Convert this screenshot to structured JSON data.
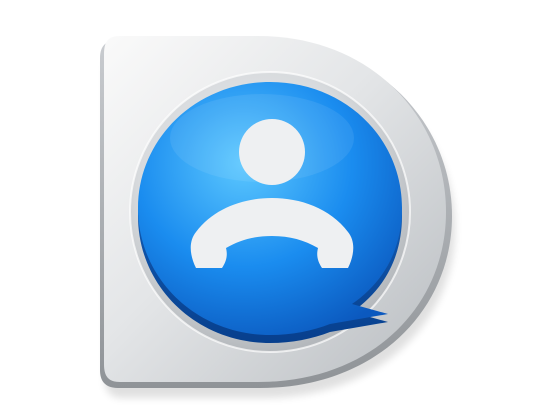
{
  "app_icon": {
    "icon_name": "contact-chat-bubble-icon",
    "base_shape": "D-shaped silver plate",
    "bubble_shape": "speech bubble",
    "glyph": "person silhouette with telephone handset",
    "colors": {
      "plate_light": "#f4f5f6",
      "plate_mid": "#d9dcdf",
      "plate_dark": "#a9adb1",
      "bubble_light": "#4fc3ff",
      "bubble_mid": "#1688ea",
      "bubble_dark": "#0a4fa8",
      "glyph": "#eef0f2",
      "background": "#ffffff"
    }
  }
}
